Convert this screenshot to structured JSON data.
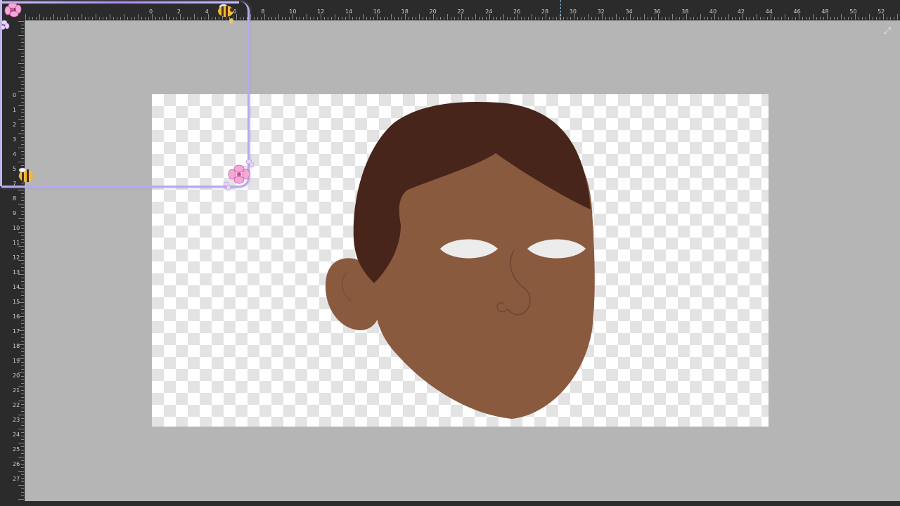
{
  "ruler": {
    "top_labels": [
      "0",
      "2",
      "4",
      "6",
      "8",
      "10",
      "12",
      "14",
      "16",
      "18",
      "20",
      "22",
      "24",
      "26",
      "28",
      "30",
      "32",
      "34",
      "36",
      "38",
      "40",
      "42",
      "44",
      "46",
      "48",
      "50",
      "52"
    ],
    "left_labels": [
      "0",
      "1",
      "2",
      "3",
      "4",
      "5",
      "7",
      "8",
      "9",
      "10",
      "11",
      "12",
      "13",
      "14",
      "15",
      "16",
      "17",
      "18",
      "19",
      "20",
      "21",
      "22",
      "23",
      "24",
      "25",
      "26",
      "27"
    ]
  },
  "canvas": {
    "transparency": "checkerboard",
    "colors": {
      "skin": "#8a5a3e",
      "hair": "#47251a",
      "eye_white": "#f2f2f2",
      "line": "#6b4533",
      "checker_light": "#ffffff",
      "checker_dark": "#e3e3e3",
      "workspace": "#b5b5b5",
      "ruler_bg": "#2b2b2b",
      "overlay_frame": "#b7a9ee"
    }
  },
  "icons": {
    "expand": "expand-arrows-icon",
    "bee_top": "bee-icon",
    "bee_left": "bee-icon",
    "flower_top": "flower-icon",
    "flower_bottom": "flower-icon"
  }
}
